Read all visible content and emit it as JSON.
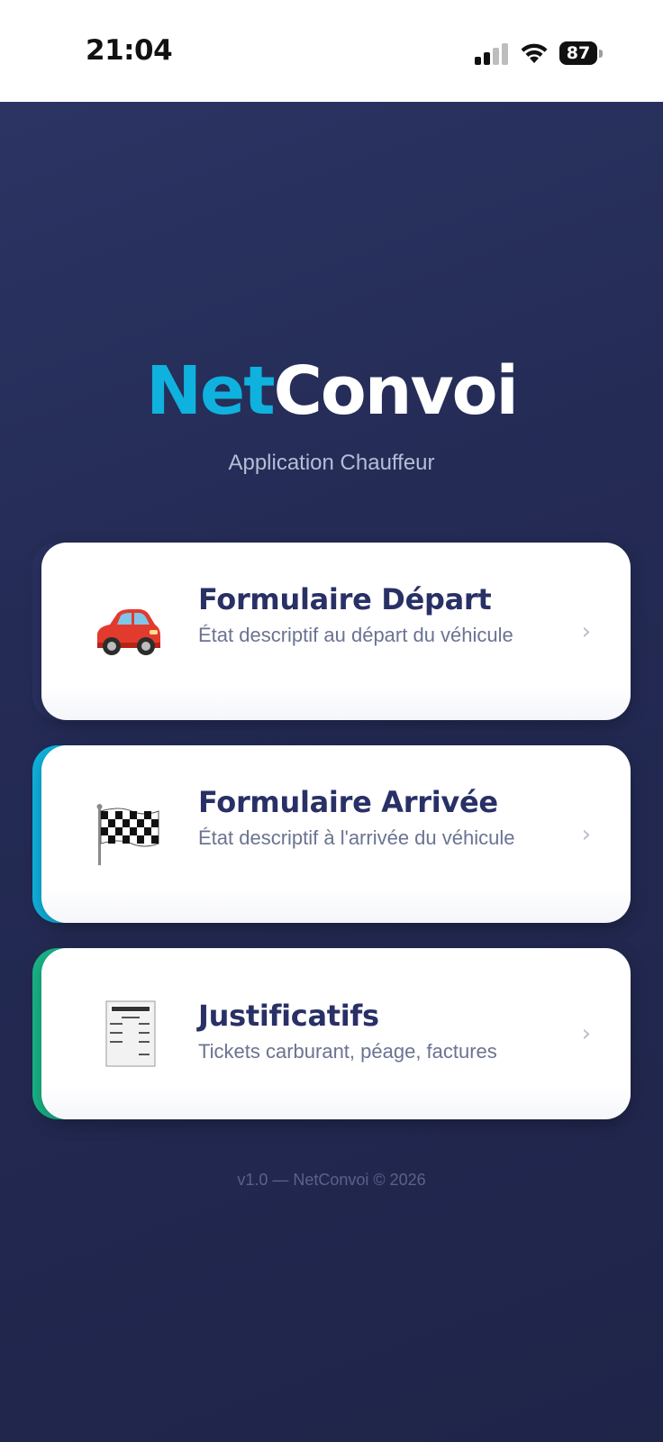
{
  "status_bar": {
    "time": "21:04",
    "battery": "87",
    "icons": [
      "signal-icon",
      "wifi-icon",
      "battery-icon"
    ]
  },
  "app": {
    "logo_part1": "Net",
    "logo_part2": "Convoi",
    "subtitle": "Application Chauffeur",
    "colors": {
      "background": "#242b55",
      "brand_cyan": "#0fb2de",
      "title_navy": "#293066",
      "accent_green": "#19b487"
    }
  },
  "menu": {
    "items": [
      {
        "icon": "car-icon",
        "title": "Formulaire Départ",
        "description": "État descriptif au départ du véhicule",
        "accent_color": "#2a3160"
      },
      {
        "icon": "checkered-flag-icon",
        "title": "Formulaire Arrivée",
        "description": "État descriptif à l'arrivée du véhicule",
        "accent_color": "#0fb2de"
      },
      {
        "icon": "receipt-icon",
        "title": "Justificatifs",
        "description": "Tickets carburant, péage, factures",
        "accent_color": "#19b487"
      }
    ]
  },
  "footer": {
    "text": "v1.0 — NetConvoi © 2026"
  }
}
